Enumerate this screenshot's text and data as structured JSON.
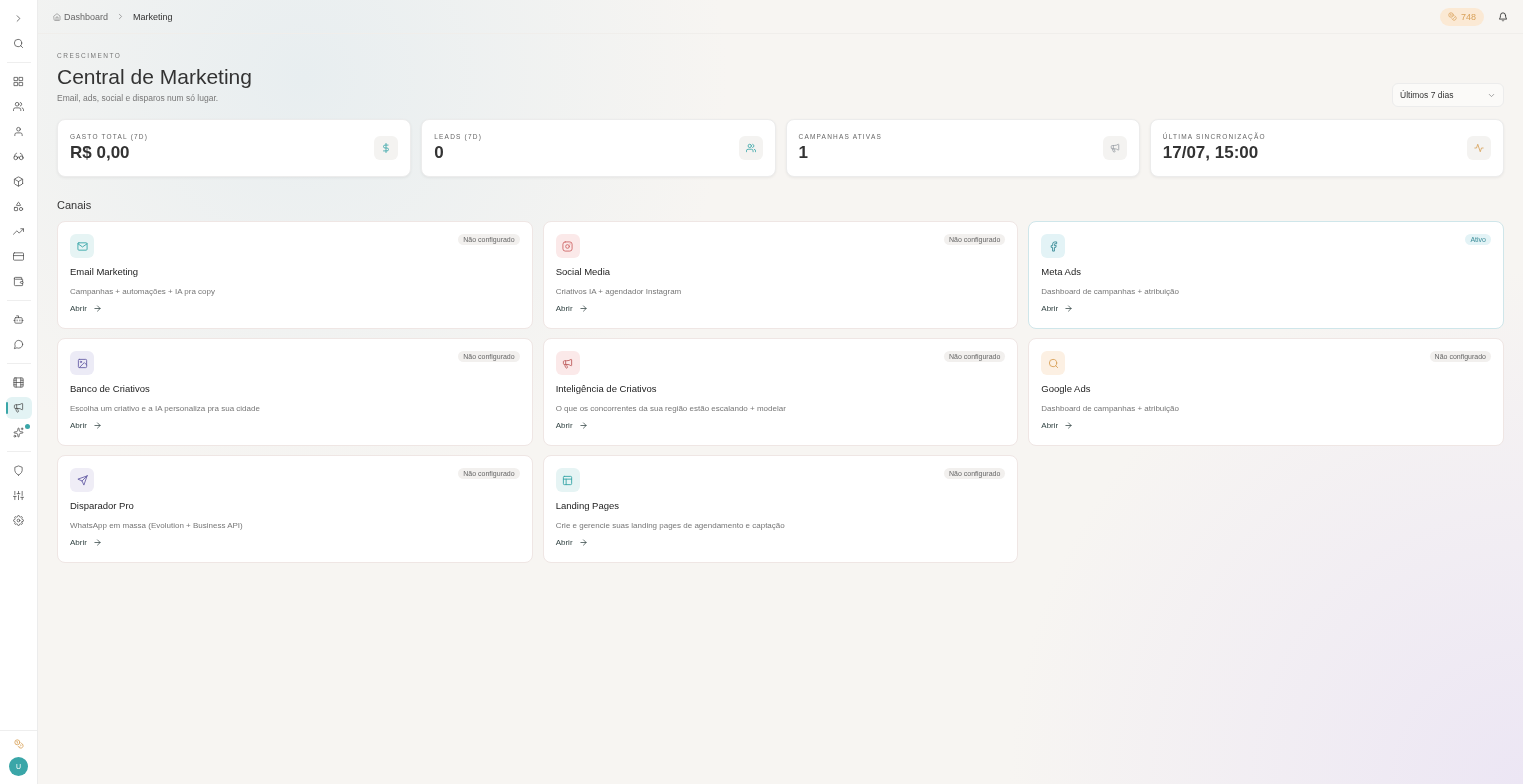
{
  "sidebar": {
    "top": [
      {
        "selected": false
      },
      {
        "selected": false
      }
    ],
    "groups": [
      [
        {
          "selected": false
        },
        {
          "selected": false
        },
        {
          "selected": false
        },
        {
          "selected": false
        },
        {
          "selected": false
        },
        {
          "selected": false
        },
        {
          "selected": false
        },
        {
          "selected": false
        },
        {
          "selected": false
        }
      ],
      [
        {
          "selected": false
        },
        {
          "selected": false
        }
      ],
      [
        {
          "selected": false,
          "badge": false
        },
        {
          "selected": true,
          "badge": false
        },
        {
          "selected": false,
          "badge": true
        }
      ],
      [
        {
          "selected": false
        },
        {
          "selected": false
        },
        {
          "selected": false
        }
      ]
    ],
    "avatar": "U"
  },
  "breadcrumb": [
    "Dashboard",
    "Marketing"
  ],
  "credits": "748",
  "header": {
    "eyebrow": "CRESCIMENTO",
    "title": "Central de Marketing",
    "subtitle": "Email, ads, social e disparos num só lugar.",
    "period": "Últimos 7 dias"
  },
  "stats": [
    {
      "label": "GASTO TOTAL (7D)",
      "value": "R$ 0,00"
    },
    {
      "label": "LEADS (7D)",
      "value": "0"
    },
    {
      "label": "CAMPANHAS ATIVAS",
      "value": "1"
    },
    {
      "label": "ÚLTIMA SINCRONIZAÇÃO",
      "value": "17/07, 15:00"
    }
  ],
  "section": "Canais",
  "channels": [
    {
      "title": "Email Marketing",
      "description": "Campanhas + automações + IA pra copy",
      "status": "Não configurado",
      "active": false,
      "color": "#e6f4f4",
      "link": "Abrir"
    },
    {
      "title": "Social Media",
      "description": "Criativos IA + agendador Instagram",
      "status": "Não configurado",
      "active": false,
      "color": "#fbe9e9",
      "link": "Abrir"
    },
    {
      "title": "Meta Ads",
      "description": "Dashboard de campanhas + atribuição",
      "status": "Ativo",
      "active": true,
      "color": "#e3f3f6",
      "link": "Abrir"
    },
    {
      "title": "Banco de Criativos",
      "description": "Escolha um criativo e a IA personaliza pra sua cidade",
      "status": "Não configurado",
      "active": false,
      "color": "#ecebf6",
      "link": "Abrir"
    },
    {
      "title": "Inteligência de Criativos",
      "description": "O que os concorrentes da sua região estão escalando + modelar",
      "status": "Não configurado",
      "active": false,
      "color": "#fbe9e9",
      "link": "Abrir"
    },
    {
      "title": "Google Ads",
      "description": "Dashboard de campanhas + atribuição",
      "status": "Não configurado",
      "active": false,
      "color": "#fcf0e3",
      "link": "Abrir"
    },
    {
      "title": "Disparador Pro",
      "description": "WhatsApp em massa (Evolution + Business API)",
      "status": "Não configurado",
      "active": false,
      "color": "#efedf6",
      "link": "Abrir"
    },
    {
      "title": "Landing Pages",
      "description": "Crie e gerencie suas landing pages de agendamento e captação",
      "status": "Não configurado",
      "active": false,
      "color": "#e6f4f4",
      "link": "Abrir"
    }
  ]
}
